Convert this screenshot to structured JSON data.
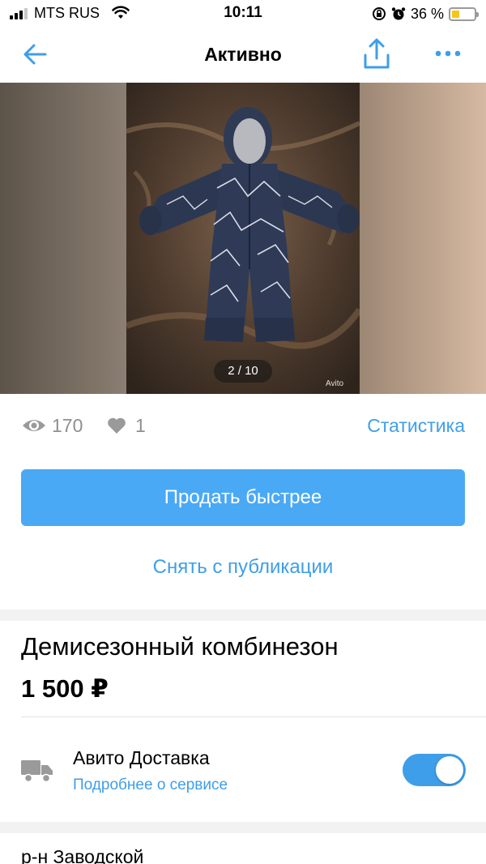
{
  "status_bar": {
    "carrier": "MTS RUS",
    "time": "10:11",
    "battery_percent": "36 %",
    "battery_level": 0.36,
    "battery_color": "#f5c518"
  },
  "nav": {
    "title": "Активно",
    "back_icon": "arrow-left-icon",
    "share_icon": "share-icon",
    "more_icon": "more-dots-icon"
  },
  "gallery": {
    "counter": "2 / 10",
    "watermark": "Avito"
  },
  "stats": {
    "views": "170",
    "likes": "1",
    "statistics_link": "Статистика"
  },
  "actions": {
    "sell_faster": "Продать быстрее",
    "unpublish": "Снять с публикации"
  },
  "listing": {
    "title": "Демисезонный комбинезон",
    "price": "1 500 ₽"
  },
  "delivery": {
    "title": "Авито Доставка",
    "link": "Подробнее о сервисе",
    "enabled": true
  },
  "location": {
    "district": "р-н Заводской"
  },
  "colors": {
    "accent": "#3e9ee9",
    "button": "#4aa9f5",
    "muted": "#8f8f8f"
  }
}
